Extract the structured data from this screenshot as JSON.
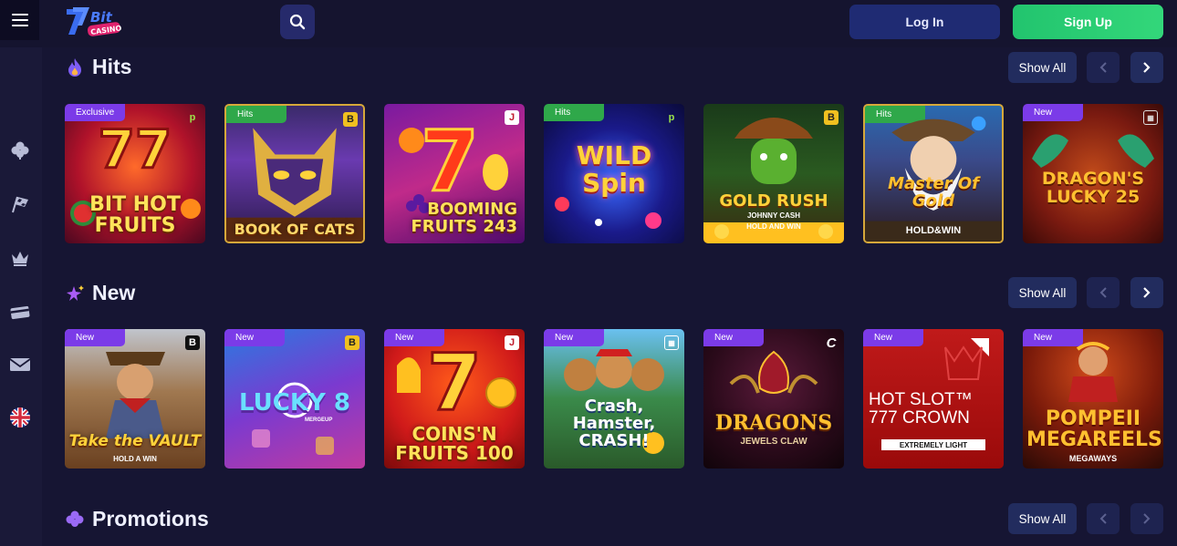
{
  "header": {
    "logo_text": "Bit Casino",
    "login_label": "Log In",
    "signup_label": "Sign Up"
  },
  "sidebar": {
    "items": [
      {
        "icon": "clover-icon"
      },
      {
        "icon": "racing-flag-icon"
      },
      {
        "icon": "crown-icon"
      },
      {
        "icon": "card-icon"
      },
      {
        "icon": "mail-icon"
      },
      {
        "icon": "uk-flag-icon"
      }
    ]
  },
  "sections": [
    {
      "title": "Hits",
      "icon": "fire-icon",
      "show_all": "Show All",
      "games": [
        {
          "name": "BIT HOT FRUITS",
          "badge": "Exclusive",
          "provider": "p"
        },
        {
          "name": "BOOK OF CATS",
          "badge": "Hits",
          "provider": "B"
        },
        {
          "name": "BOOMING FRUITS 243",
          "badge": "",
          "provider": ""
        },
        {
          "name": "WILD Spin",
          "badge": "Hits",
          "provider": "p"
        },
        {
          "name": "GOLD RUSH",
          "subtitle": "JOHNNY CASH",
          "tag": "HOLD AND WIN",
          "badge": "",
          "provider": "B"
        },
        {
          "name": "Master Of Gold",
          "tag": "HOLD&WIN",
          "badge": "Hits",
          "provider": ""
        },
        {
          "name": "DRAGON'S LUCKY 25",
          "badge": "New",
          "provider": ""
        }
      ]
    },
    {
      "title": "New",
      "icon": "sparkle-icon",
      "show_all": "Show All",
      "games": [
        {
          "name": "Take the VAULT",
          "tag": "HOLD A WIN",
          "badge": "New",
          "provider": "B"
        },
        {
          "name": "LUCKY 8",
          "tag": "MERGEUP",
          "badge": "New",
          "provider": "B"
        },
        {
          "name": "COINS'N FRUITS 100",
          "badge": "New",
          "provider": ""
        },
        {
          "name": "Crash, Hamster, CRASH!",
          "badge": "New",
          "provider": ""
        },
        {
          "name": "DRAGONS",
          "tag": "JEWELS CLAW",
          "badge": "New",
          "provider": "C"
        },
        {
          "name": "HOT SLOT™ 777 CROWN",
          "tag": "EXTREMELY LIGHT",
          "badge": "New",
          "provider": ""
        },
        {
          "name": "POMPEII MEGAREELS",
          "tag": "MEGAWAYS",
          "badge": "New",
          "provider": ""
        }
      ]
    },
    {
      "title": "Promotions",
      "icon": "clover-icon",
      "show_all": "Show All"
    }
  ]
}
